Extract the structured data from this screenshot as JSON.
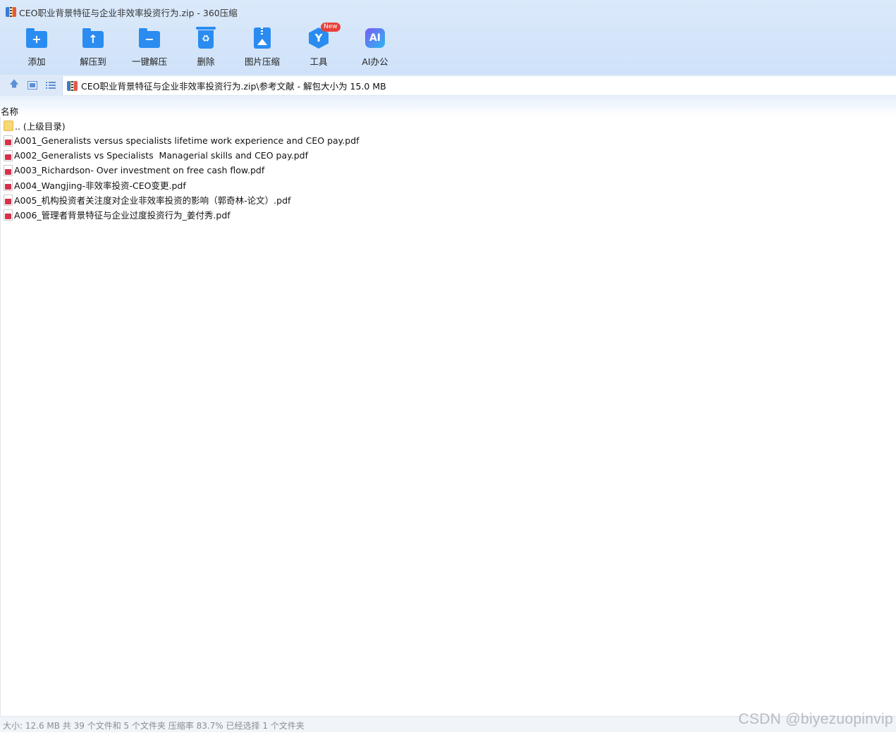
{
  "window": {
    "title": "CEO职业背景特征与企业非效率投资行为.zip - 360压缩"
  },
  "toolbar": {
    "items": [
      {
        "label": "添加",
        "icon": "add-folder-icon"
      },
      {
        "label": "解压到",
        "icon": "extract-to-icon"
      },
      {
        "label": "一键解压",
        "icon": "one-click-extract-icon"
      },
      {
        "label": "删除",
        "icon": "recycle-bin-icon"
      },
      {
        "label": "图片压缩",
        "icon": "image-compress-icon"
      },
      {
        "label": "工具",
        "icon": "tools-cube-icon",
        "badge": "New"
      },
      {
        "label": "AI办公",
        "icon": "ai-office-icon",
        "icon_text": "AI"
      }
    ]
  },
  "address": {
    "path": "CEO职业背景特征与企业非效率投资行为.zip\\参考文献 - 解包大小为 15.0 MB"
  },
  "columns": {
    "name": "名称"
  },
  "files": [
    {
      "name": ".. (上级目录)",
      "type": "parent-folder"
    },
    {
      "name": "A001_Generalists versus specialists lifetime work experience and CEO pay.pdf",
      "type": "pdf"
    },
    {
      "name": "A002_Generalists vs Specialists  Managerial skills and CEO pay.pdf",
      "type": "pdf"
    },
    {
      "name": "A003_Richardson- Over investment on free cash flow.pdf",
      "type": "pdf"
    },
    {
      "name": "A004_Wangjing-非效率投资-CEO变更.pdf",
      "type": "pdf"
    },
    {
      "name": "A005_机构投资者关注度对企业非效率投资的影响（郭奇林-论文）.pdf",
      "type": "pdf"
    },
    {
      "name": "A006_管理者背景特征与企业过度投资行为_姜付秀.pdf",
      "type": "pdf"
    }
  ],
  "status": {
    "text": "大小: 12.6 MB 共 39 个文件和 5 个文件夹 压缩率 83.7% 已经选择 1 个文件夹"
  },
  "watermark": "CSDN @biyezuopinvip",
  "colors": {
    "toolbar_bg": "#d6e6fa",
    "icon_blue": "#2a8cf0",
    "badge_red": "#e8413a",
    "pdf_red": "#d6304a",
    "folder_yellow": "#f8d775"
  }
}
